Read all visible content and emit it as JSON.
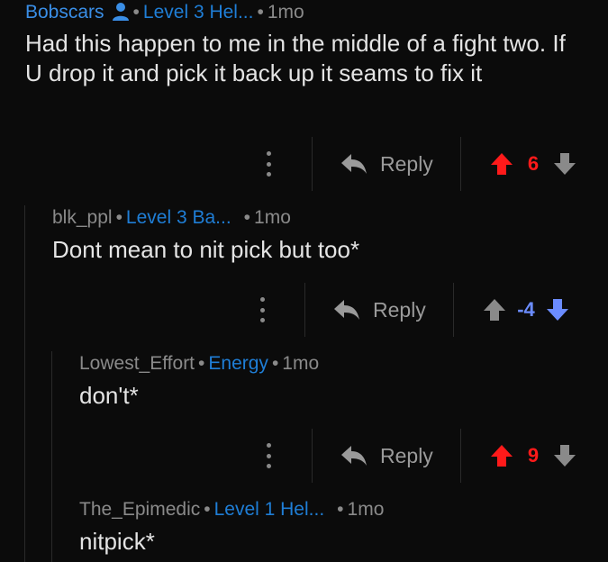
{
  "comments": [
    {
      "author": "Bobscars",
      "flair": "Level 3 Hel...",
      "time": "1mo",
      "body": "Had this happen to me in the middle of a fight two. If U drop it and pick it back up it seams to fix it",
      "reply_label": "Reply",
      "score": "6",
      "vote_state": "upvoted"
    },
    {
      "author": "blk_ppl",
      "flair": "Level 3 Ba...",
      "time": "1mo",
      "body": "Dont mean to nit pick but too*",
      "reply_label": "Reply",
      "score": "-4",
      "vote_state": "downvoted"
    },
    {
      "author": "Lowest_Effort",
      "flair": "Energy",
      "time": "1mo",
      "body": "don't*",
      "reply_label": "Reply",
      "score": "9",
      "vote_state": "upvoted"
    },
    {
      "author": "The_Epimedic",
      "flair": "Level 1 Hel...",
      "time": "1mo",
      "body": "nitpick*"
    }
  ],
  "colors": {
    "background": "#0b0b0b",
    "upvote": "#ff1a1a",
    "downvote": "#6b8cff",
    "neutral_arrow": "#8a8a8a",
    "flair": "#1f7ed6",
    "text": "#e4e4e4"
  },
  "icons": {
    "op_badge": "person-icon",
    "more": "kebab-menu-icon",
    "reply": "reply-arrow-icon",
    "upvote": "upvote-arrow-icon",
    "downvote": "downvote-arrow-icon"
  }
}
